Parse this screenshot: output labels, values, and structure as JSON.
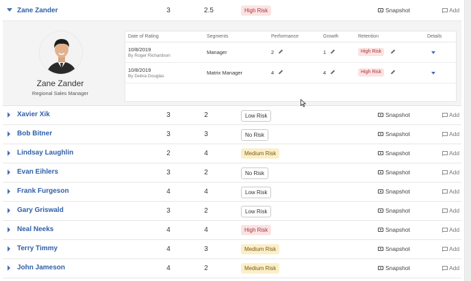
{
  "colors": {
    "link": "#2f5fa8",
    "high_risk_bg": "#fbe3e3",
    "high_risk_text": "#a8343a",
    "medium_risk_bg": "#fbefc9",
    "panel_bg": "#f4f4f4"
  },
  "actions": {
    "snapshot_label": "Snapshot",
    "add_label": "Add"
  },
  "expanded_row": {
    "name": "Zane Zander",
    "performance": "3",
    "growth": "2.5",
    "risk": "High Risk",
    "profile": {
      "name": "Zane Zander",
      "title": "Regional Sales Manager"
    },
    "history": {
      "headers": {
        "date": "Date of Rating",
        "segments": "Segments",
        "performance": "Performance",
        "growth": "Growth",
        "retention": "Retention",
        "details": "Details"
      },
      "rows": [
        {
          "date": "10/8/2019",
          "by": "By Roger Richardson",
          "segment": "Manager",
          "performance": "2",
          "growth": "1",
          "retention": "High Risk"
        },
        {
          "date": "10/8/2019",
          "by": "By Debra Douglas",
          "segment": "Matrix Manager",
          "performance": "4",
          "growth": "4",
          "retention": "High Risk"
        }
      ]
    }
  },
  "employees": [
    {
      "name": "Xavier Xik",
      "performance": "3",
      "growth": "2",
      "risk": "Low Risk"
    },
    {
      "name": "Bob Bitner",
      "performance": "3",
      "growth": "3",
      "risk": "No Risk"
    },
    {
      "name": "Lindsay Laughlin",
      "performance": "2",
      "growth": "4",
      "risk": "Medium Risk"
    },
    {
      "name": "Evan Eihlers",
      "performance": "3",
      "growth": "2",
      "risk": "No Risk"
    },
    {
      "name": "Frank Furgeson",
      "performance": "4",
      "growth": "4",
      "risk": "Low Risk"
    },
    {
      "name": "Gary Griswald",
      "performance": "3",
      "growth": "2",
      "risk": "Low Risk"
    },
    {
      "name": "Neal Neeks",
      "performance": "4",
      "growth": "4",
      "risk": "High Risk"
    },
    {
      "name": "Terry Timmy",
      "performance": "4",
      "growth": "3",
      "risk": "Medium Risk"
    },
    {
      "name": "John Jameson",
      "performance": "4",
      "growth": "2",
      "risk": "Medium Risk"
    }
  ]
}
